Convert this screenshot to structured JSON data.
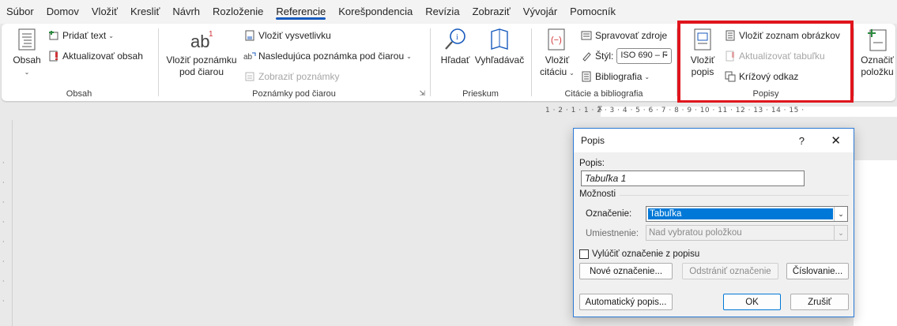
{
  "tabs": [
    "Súbor",
    "Domov",
    "Vložiť",
    "Kresliť",
    "Návrh",
    "Rozloženie",
    "Referencie",
    "Korešpondencia",
    "Revízia",
    "Zobraziť",
    "Vývojár",
    "Pomocník"
  ],
  "active_tab": "Referencie",
  "ribbon": {
    "obsah": {
      "group_label": "Obsah",
      "obsah_btn": "Obsah",
      "pridat_text": "Pridať text",
      "aktualizovat_obsah": "Aktualizovať obsah"
    },
    "poznamky": {
      "group_label": "Poznámky pod čiarou",
      "vlozit_poznamku_l1": "Vložiť poznámku",
      "vlozit_poznamku_l2": "pod čiarou",
      "vlozit_vysvetlivku": "Vložiť vysvetlivku",
      "nasledujuca": "Nasledujúca poznámka pod čiarou",
      "zobrazit": "Zobraziť poznámky"
    },
    "prieskum": {
      "group_label": "Prieskum",
      "hladat": "Hľadať",
      "vyhladavac": "Vyhľadávač"
    },
    "citacie": {
      "group_label": "Citácie a bibliografia",
      "vlozit_citaciu_l1": "Vložiť",
      "vlozit_citaciu_l2": "citáciu",
      "spravovat_zdroje": "Spravovať zdroje",
      "styl_label": "Štýl:",
      "styl_value": "ISO 690 – F",
      "bibliografia": "Bibliografia"
    },
    "popisy": {
      "group_label": "Popisy",
      "vlozit_popis_l1": "Vložiť",
      "vlozit_popis_l2": "popis",
      "vlozit_zoznam": "Vložiť zoznam obrázkov",
      "aktualizovat_tabulku": "Aktualizovať tabuľku",
      "krizovy_odkaz": "Krížový odkaz"
    },
    "register": {
      "oznacit_l1": "Označiť",
      "oznacit_l2": "položku"
    }
  },
  "ruler": {
    "ticks": "1 · 2 · 1 · 1 · 2 · 3 · 4 · 5 · 6 · 7 · 8 · 9 · 10 · 11 · 12 · 13 · 14 · 15 ·"
  },
  "dialog": {
    "title": "Popis",
    "help": "?",
    "close": "✕",
    "popis_label": "Popis:",
    "popis_value": "Tabuľka 1",
    "moznosti": "Možnosti",
    "oznacenie_label": "Označenie:",
    "oznacenie_value": "Tabuľka",
    "umiestnenie_label": "Umiestnenie:",
    "umiestnenie_value": "Nad vybratou položkou",
    "vylucit": "Vylúčiť označenie z popisu",
    "vylucit_checked": false,
    "nove_oznacenie": "Nové označenie...",
    "odstranit_oznacenie": "Odstrániť označenie",
    "cislovanie": "Číslovanie...",
    "automaticky_popis": "Automatický popis...",
    "ok": "OK",
    "zrusit": "Zrušiť"
  },
  "colors": {
    "accent": "#185abd",
    "highlight": "#e0151d",
    "selection": "#0078d7"
  }
}
